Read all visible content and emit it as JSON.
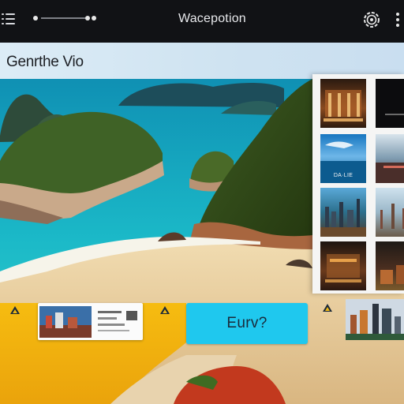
{
  "topbar": {
    "title": "Wacepotion",
    "icons": [
      "menu-icon",
      "scrubber",
      "settings-icon",
      "more-icon"
    ]
  },
  "page": {
    "heading": "Genrthe Vio"
  },
  "gallery": {
    "thumbnails": [
      {
        "caption": ""
      },
      {
        "caption": ""
      },
      {
        "caption": "DA·LIE"
      },
      {
        "caption": ""
      },
      {
        "caption": ""
      },
      {
        "caption": ""
      },
      {
        "caption": ""
      },
      {
        "caption": ""
      }
    ]
  },
  "bottom": {
    "cta_label": "Eurv?",
    "markers": [
      "triangle-marker",
      "triangle-marker",
      "triangle-marker"
    ]
  },
  "colors": {
    "accent": "#1fc8ee",
    "sea": "#19b7c8",
    "sand": "#e6c99a",
    "marker_yellow": "#f2b912"
  }
}
